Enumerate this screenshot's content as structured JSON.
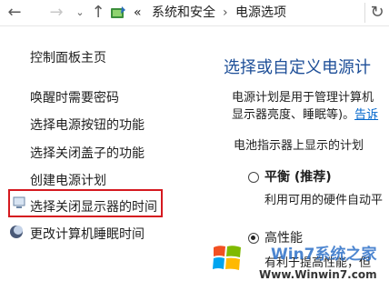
{
  "address_bar": {
    "overflow_marker": "«",
    "breadcrumbs": [
      "系统和安全",
      "电源选项"
    ]
  },
  "sidebar": {
    "items": [
      {
        "label": "控制面板主页"
      },
      {
        "label": "唤醒时需要密码"
      },
      {
        "label": "选择电源按钮的功能"
      },
      {
        "label": "选择关闭盖子的功能"
      },
      {
        "label": "创建电源计划"
      },
      {
        "label": "选择关闭显示器的时间"
      },
      {
        "label": "更改计算机睡眠时间"
      }
    ],
    "highlight_color": "#d5191f"
  },
  "main": {
    "title": "选择或自定义电源计",
    "description_line1": "电源计划是用于管理计算机",
    "description_line2": "显示器亮度、睡眠等)。",
    "description_link": "告诉",
    "battery_section_label": "电池指示器上显示的计划",
    "plans": [
      {
        "name": "平衡 (推荐)",
        "description": "利用可用的硬件自动平",
        "selected": false
      },
      {
        "name": "高性能",
        "description": "有利于提高性能，但",
        "selected": true
      }
    ],
    "title_color": "#1e4f98"
  },
  "watermark": {
    "text": "Win7系统之家",
    "url": "Www.Winwin7.com"
  }
}
